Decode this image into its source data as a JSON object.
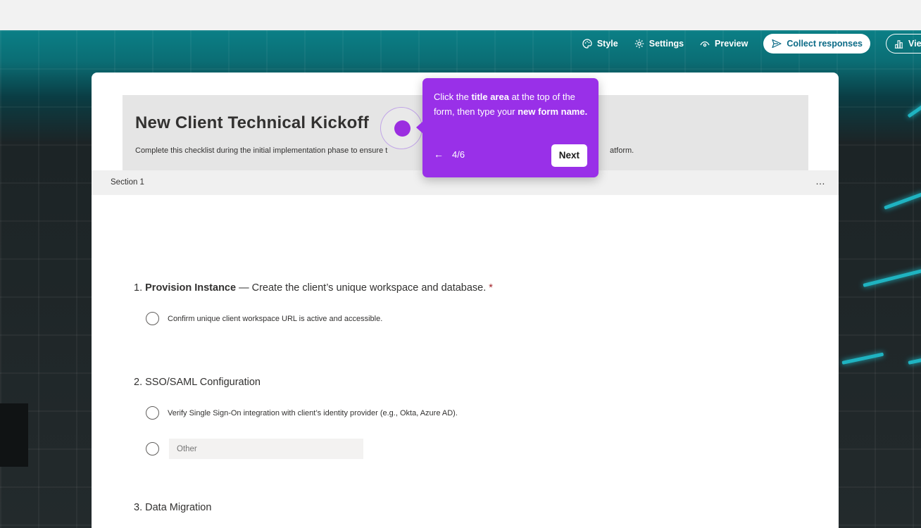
{
  "toolbar": {
    "style_label": "Style",
    "settings_label": "Settings",
    "preview_label": "Preview",
    "collect_label": "Collect responses",
    "view_label": "Vie"
  },
  "form": {
    "title": "New Client Technical Kickoff",
    "description_start": "Complete this checklist during the initial implementation phase to ensure t",
    "description_end": "atform.",
    "section_label": "Section 1",
    "section_more": "…"
  },
  "questions": [
    {
      "number": "1.",
      "title_bold": "Provision Instance",
      "title_rest": " — Create the client’s unique workspace and database.",
      "required_mark": "*",
      "options": [
        "Confirm unique client workspace URL is active and accessible."
      ]
    },
    {
      "number": "2.",
      "title": "SSO/SAML Configuration",
      "options": [
        "Verify Single Sign-On integration with client’s identity provider (e.g., Okta, Azure AD)."
      ],
      "other_placeholder": "Other"
    },
    {
      "number": "3.",
      "title": "Data Migration"
    }
  ],
  "tour_tooltip": {
    "text_1": "Click the ",
    "text_bold_1": "title area",
    "text_2": " at the top of the form, then type your ",
    "text_bold_2": "new form name.",
    "back_arrow": "←",
    "step": "4/6",
    "next_label": "Next"
  },
  "colors": {
    "accent_teal": "#0b7f86",
    "tooltip_purple": "#9930e8",
    "required_red": "#a4262c"
  }
}
